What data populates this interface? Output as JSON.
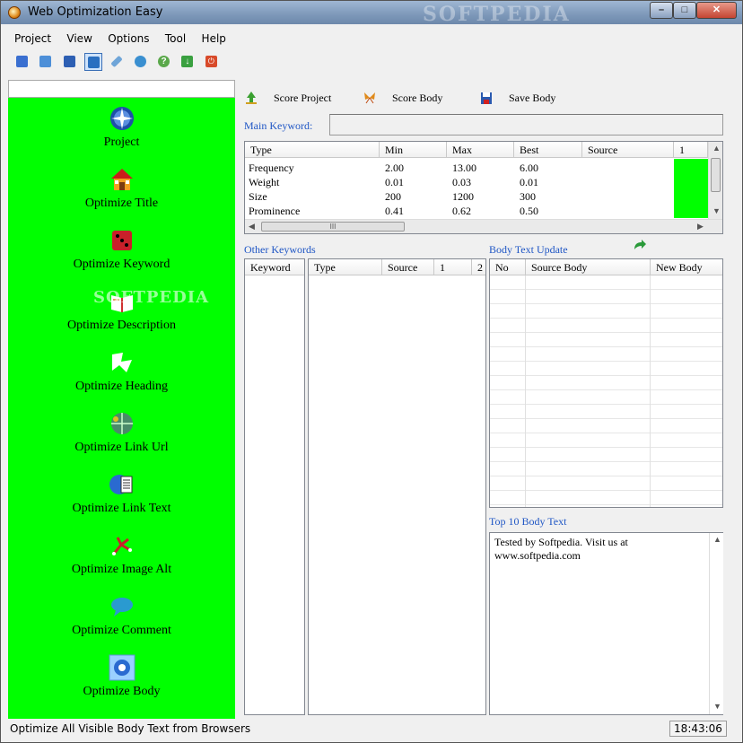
{
  "window": {
    "title": "Web Optimization Easy",
    "watermark": "SOFTPEDIA",
    "controls": {
      "minimize": "–",
      "maximize": "□",
      "close": "✕"
    }
  },
  "menu": [
    "Project",
    "View",
    "Options",
    "Tool",
    "Help"
  ],
  "toolbar": {
    "icons": [
      {
        "name": "new-icon",
        "color": "#3a6fd0"
      },
      {
        "name": "open-icon",
        "color": "#4d8fd8"
      },
      {
        "name": "save-icon",
        "color": "#2d5fb3"
      },
      {
        "name": "refresh-icon",
        "color": "#2a6fc0"
      },
      {
        "name": "edit-icon",
        "color": "#6fa5d8"
      },
      {
        "name": "browser-icon",
        "color": "#3a8fd0"
      },
      {
        "name": "help-icon",
        "color": "#5aa84a"
      },
      {
        "name": "download-icon",
        "color": "#3aa040"
      },
      {
        "name": "power-icon",
        "color": "#d84a2a"
      }
    ]
  },
  "sidebar": {
    "background": "#00ff00",
    "watermark": "SOFTPEDIA",
    "items": [
      {
        "label": "Project",
        "icon": "globe-icon"
      },
      {
        "label": "Optimize Title",
        "icon": "house-icon"
      },
      {
        "label": "Optimize Keyword",
        "icon": "dice-icon"
      },
      {
        "label": "Optimize Description",
        "icon": "book-icon"
      },
      {
        "label": "Optimize Heading",
        "icon": "arrows-icon"
      },
      {
        "label": "Optimize Link Url",
        "icon": "network-globe-icon"
      },
      {
        "label": "Optimize Link Text",
        "icon": "document-globe-icon"
      },
      {
        "label": "Optimize Image Alt",
        "icon": "pixel-figure-icon"
      },
      {
        "label": "Optimize Comment",
        "icon": "speech-bubble-icon"
      },
      {
        "label": "Optimize Body",
        "icon": "gear-icon"
      }
    ]
  },
  "actions": {
    "score_project": "Score Project",
    "score_body": "Score Body",
    "save_body": "Save Body"
  },
  "main_keyword": {
    "label": "Main Keyword:",
    "value": ""
  },
  "metrics_table": {
    "columns": [
      "Type",
      "Min",
      "Max",
      "Best",
      "Source",
      "1"
    ],
    "rows": [
      [
        "Frequency",
        "2.00",
        "13.00",
        "6.00",
        "",
        ""
      ],
      [
        "Weight",
        "0.01",
        "0.03",
        "0.01",
        "",
        ""
      ],
      [
        "Size",
        "200",
        "1200",
        "300",
        "",
        ""
      ],
      [
        "Prominence",
        "0.41",
        "0.62",
        "0.50",
        "",
        ""
      ]
    ],
    "highlight_color": "#00ff00",
    "hscroll_grip": "III"
  },
  "other_keywords": {
    "label": "Other Keywords",
    "keyword_column": "Keyword",
    "columns": [
      "Type",
      "Source",
      "1",
      "2"
    ]
  },
  "body_text_update": {
    "label": "Body Text Update",
    "columns": [
      "No",
      "Source Body",
      "New Body"
    ]
  },
  "top10": {
    "label": "Top 10 Body Text",
    "text": "Tested by Softpedia. Visit us at\nwww.softpedia.com"
  },
  "status": {
    "text": "Optimize All Visible Body Text from Browsers",
    "time": "18:43:06"
  }
}
